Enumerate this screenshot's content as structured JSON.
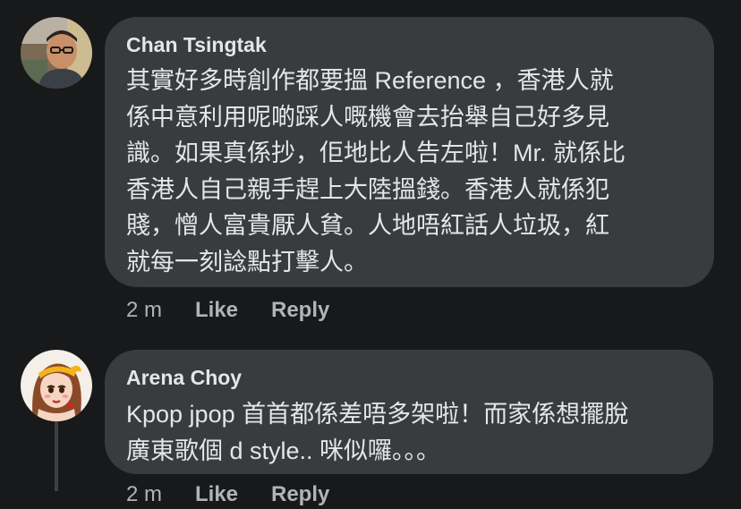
{
  "comments": [
    {
      "author": "Chan Tsingtak",
      "lines": [
        "其實好多時創作都要搵 Reference ，香港人就",
        "係中意利用呢啲踩人嘅機會去抬舉自己好多見",
        "識。如果真係抄，佢地比人告左啦！Mr. 就係比",
        "香港人自己親手趕上大陸搵錢。香港人就係犯",
        "賤，憎人富貴厭人貧。人地唔紅話人垃圾，紅",
        "就每一刻諗點打擊人。"
      ],
      "time": "2 m",
      "like": "Like",
      "reply": "Reply"
    },
    {
      "author": "Arena Choy",
      "lines": [
        "Kpop jpop 首首都係差唔多架啦！而家係想擺脫",
        "廣東歌個 d style.. 咪似囉。。。"
      ],
      "time": "2 m",
      "like": "Like",
      "reply": "Reply"
    }
  ],
  "colors": {
    "background": "#18191a",
    "bubble": "#3a3b3c",
    "text": "#e4e6eb",
    "secondary_text": "#b0b3b8"
  }
}
